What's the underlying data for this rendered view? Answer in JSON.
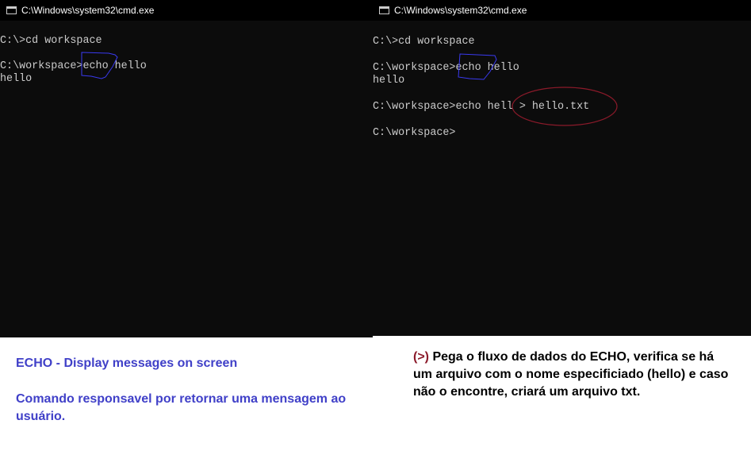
{
  "left_window": {
    "title": "C:\\Windows\\system32\\cmd.exe",
    "lines": [
      "C:\\>cd workspace",
      "C:\\workspace>echo hello",
      "hello"
    ]
  },
  "right_window": {
    "title": "C:\\Windows\\system32\\cmd.exe",
    "lines": [
      "C:\\>cd workspace",
      "C:\\workspace>echo hello",
      "hello",
      "C:\\workspace>echo hell > hello.txt",
      "C:\\workspace>"
    ]
  },
  "notes": {
    "left_heading": "ECHO - Display messages on screen",
    "left_body": "Comando responsavel por retornar uma mensagem ao usuário.",
    "right_symbol": "(>)",
    "right_body": " Pega o fluxo de dados do ECHO, verifica se há um arquivo com o nome especificiado (hello) e caso não o encontre, criará um arquivo txt."
  },
  "colors": {
    "terminal_bg": "#0c0c0c",
    "terminal_text": "#cccccc",
    "blue_annotation": "#3a3af0",
    "red_annotation": "#8b1a2a"
  }
}
